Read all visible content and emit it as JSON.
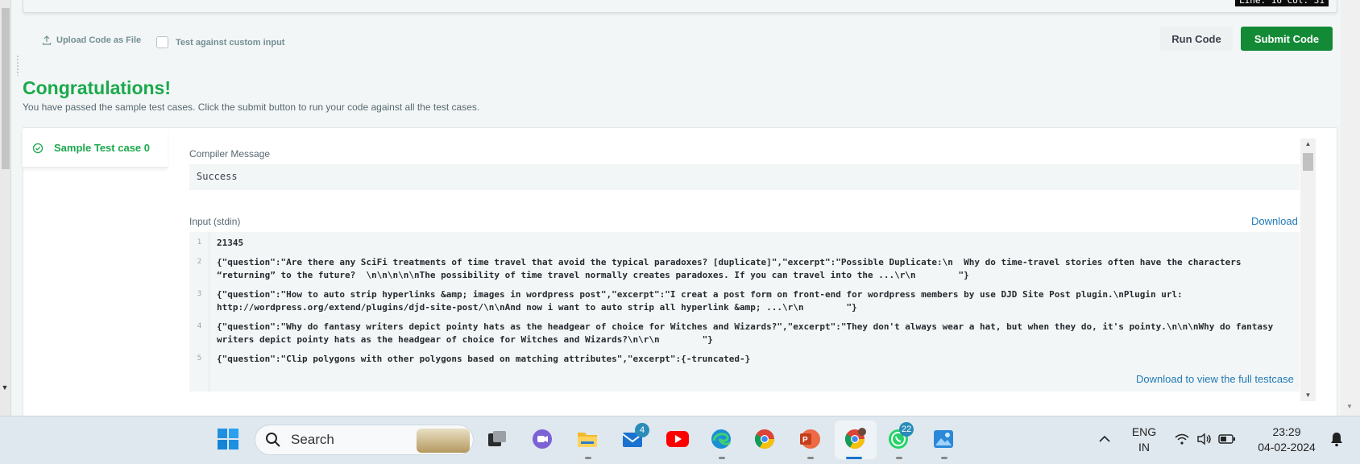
{
  "editor": {
    "status": "Line: 16 Col: 31"
  },
  "actions": {
    "upload_label": "Upload Code as File",
    "custom_input_label": "Test against custom input",
    "run_label": "Run Code",
    "submit_label": "Submit Code"
  },
  "result": {
    "title": "Congratulations!",
    "subtitle": "You have passed the sample test cases. Click the submit button to run your code against all the test cases.",
    "testcase_tab": "Sample Test case 0",
    "compiler_label": "Compiler Message",
    "compiler_message": "Success",
    "input_label": "Input (stdin)",
    "download_label": "Download",
    "download_full_label": "Download to view the full testcase",
    "input_lines": [
      {
        "n": "1",
        "text": "21345"
      },
      {
        "n": "2",
        "text": "{\"question\":\"Are there any SciFi treatments of time travel that avoid the typical paradoxes? [duplicate]\",\"excerpt\":\"Possible Duplicate:\\n  Why do time-travel stories often have the characters “returning” to the future?  \\n\\n\\n\\n\\nThe possibility of time travel normally creates paradoxes. If you can travel into the ...\\r\\n        \"}"
      },
      {
        "n": "3",
        "text": "{\"question\":\"How to auto strip hyperlinks &amp; images in wordpress post\",\"excerpt\":\"I creat a post form on front-end for wordpress members by use DJD Site Post plugin.\\nPlugin url: http://wordpress.org/extend/plugins/djd-site-post/\\n\\nAnd now i want to auto strip all hyperlink &amp; ...\\r\\n        \"}"
      },
      {
        "n": "4",
        "text": "{\"question\":\"Why do fantasy writers depict pointy hats as the headgear of choice for Witches and Wizards?\",\"excerpt\":\"They don't always wear a hat, but when they do, it's pointy.\\n\\n\\nWhy do fantasy writers depict pointy hats as the headgear of choice for Witches and Wizards?\\n\\r\\n        \"}"
      },
      {
        "n": "5",
        "text": "{\"question\":\"Clip polygons with other polygons based on matching attributes\",\"excerpt\":{-truncated-}"
      }
    ]
  },
  "taskbar": {
    "search_placeholder": "Search",
    "mail_badge": "4",
    "whatsapp_badge": "22",
    "lang_top": "ENG",
    "lang_bottom": "IN",
    "time": "23:29",
    "date": "04-02-2024",
    "colors": {
      "submit": "#138a36",
      "success": "#1ba94c",
      "link": "#1f7ab8"
    }
  }
}
